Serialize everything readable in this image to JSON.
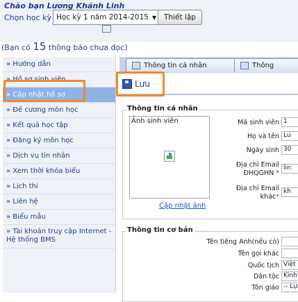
{
  "header": {
    "greeting": "Chào bạn Lương Khánh Linh",
    "semester_label": "Chọn học kỳ",
    "semester_value": "Học kỳ 1 năm 2014-2015",
    "setup_button": "Thiết lập"
  },
  "notice": {
    "prefix": "(Bạn có ",
    "count": "15",
    "suffix": " thông báo chưa đọc)"
  },
  "sidebar": {
    "items": [
      {
        "label": "» Hướng dẫn"
      },
      {
        "label": "» Hồ sơ sinh viên"
      },
      {
        "label": "» Cập nhật hồ sơ"
      },
      {
        "label": "» Đề cương môn học"
      },
      {
        "label": "» Kết quả học tập"
      },
      {
        "label": "» Đăng ký môn học"
      },
      {
        "label": "» Dịch vụ tin nhắn"
      },
      {
        "label": "» Xem thời khóa biểu"
      },
      {
        "label": "» Lịch thi"
      },
      {
        "label": "» Liên hệ"
      },
      {
        "label": "» Biểu mẫu"
      },
      {
        "label": "» Tài khoản truy cập Internet - Hệ thống BMS"
      }
    ]
  },
  "tabs": {
    "personal": "Thông tin cá nhân",
    "other": "Thông"
  },
  "toolbar": {
    "save": "Lưu"
  },
  "personal_info": {
    "legend": "Thông tin cá nhân",
    "photo_label": "Ảnh sinh viên",
    "update_photo": "Cập nhật ảnh",
    "fields": {
      "student_id": {
        "label": "Mã sinh viên",
        "value": "1"
      },
      "full_name": {
        "label": "Họ và tên",
        "value": "Lu"
      },
      "birth_date": {
        "label": "Ngày sinh",
        "value": "30"
      },
      "email_dhqghn": {
        "label_line1": "Địa chỉ Email",
        "label_line2": "ĐHQGHN",
        "required": "*",
        "value": "lin"
      },
      "email_other": {
        "label_line1": "Địa chỉ Email",
        "label_line2": "khác",
        "required": "*",
        "value": "kh"
      }
    }
  },
  "basic_info": {
    "legend": "Thông tin cơ bản",
    "fields": {
      "english_name": {
        "label": "Tên tiếng Anh(nếu có)",
        "value": ""
      },
      "other_name": {
        "label": "Tên gọi khác",
        "value": ""
      },
      "nationality": {
        "label": "Quốc tịch",
        "value": "Việt Nam"
      },
      "ethnicity": {
        "label": "Dân tộc",
        "value": "Kinh"
      },
      "religion": {
        "label": "Tôn giáo",
        "value": "-- Lựa chọn"
      }
    }
  },
  "colors": {
    "accent_orange": "#f08a2b",
    "nav_active": "#8fb1e6",
    "link_blue": "#1a4ec8",
    "heading_blue": "#1f3a8a"
  }
}
